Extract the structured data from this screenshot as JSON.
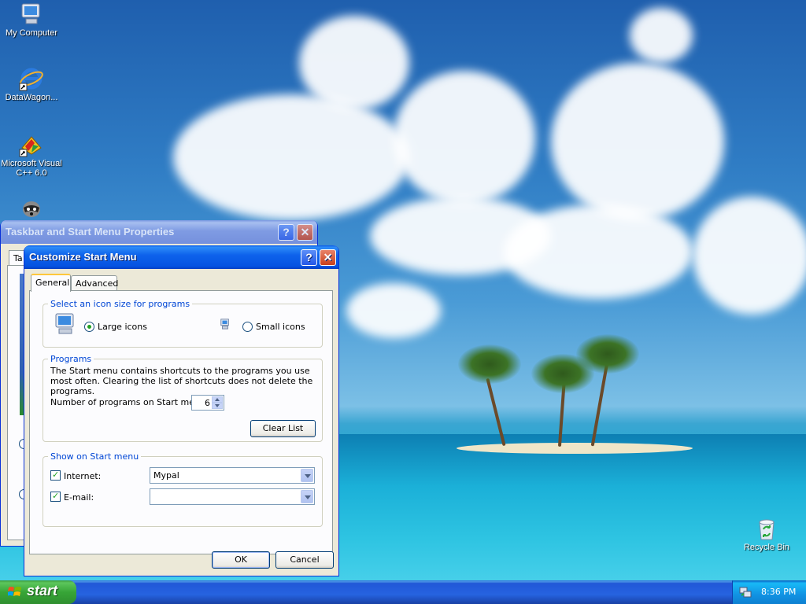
{
  "desktop": {
    "icons": [
      {
        "label": "My Computer",
        "icon": "my-computer-icon"
      },
      {
        "label": "DataWagon...",
        "icon": "internet-explorer-icon"
      },
      {
        "label_line1": "Microsoft Visual",
        "label_line2": "C++ 6.0",
        "icon": "visual-cpp-icon"
      },
      {
        "label": "Recycle Bin",
        "icon": "recycle-bin-icon"
      }
    ]
  },
  "parent_window": {
    "title": "Taskbar and Start Menu Properties",
    "tab_fragment": "Ta"
  },
  "dialog": {
    "title": "Customize Start Menu",
    "help_glyph": "?",
    "close_glyph": "✕",
    "tabs": [
      "General",
      "Advanced"
    ],
    "icon_size_group": {
      "legend": "Select an icon size for programs",
      "large_label": "Large icons",
      "small_label": "Small icons",
      "selected": "large"
    },
    "programs_group": {
      "legend": "Programs",
      "description": "The Start menu contains shortcuts to the programs you use most often. Clearing the list of shortcuts does not delete the programs.",
      "count_label": "Number of programs on Start menu:",
      "count_value": "6",
      "clear_button": "Clear List"
    },
    "show_group": {
      "legend": "Show on Start menu",
      "internet_label": "Internet:",
      "internet_checked": true,
      "internet_value": "Mypal",
      "email_label": "E-mail:",
      "email_checked": true,
      "email_value": ""
    },
    "ok_button": "OK",
    "cancel_button": "Cancel"
  },
  "taskbar": {
    "start_label": "start",
    "clock": "8:36 PM"
  },
  "colors": {
    "title_active": "#0553e1",
    "start_green": "#37a537",
    "group_legend": "#0046d5"
  }
}
